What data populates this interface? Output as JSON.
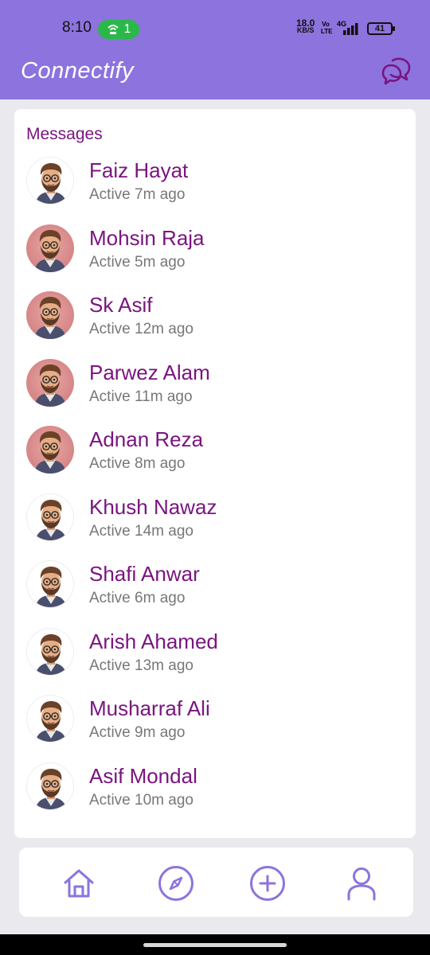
{
  "status_bar": {
    "time": "8:10",
    "hotspot_count": "1",
    "net_speed_value": "18.0",
    "net_speed_unit": "KB/S",
    "volte_label": "Vo LTE",
    "network_label": "4G",
    "battery": "41"
  },
  "app": {
    "title": "Connectify",
    "header_icon": "chat-bubbles-icon",
    "accent_color": "#8d73dd",
    "name_color": "#7a1580"
  },
  "messages": {
    "title": "Messages",
    "items": [
      {
        "name": "Faiz Hayat",
        "status": "Active 7m ago",
        "avatar": "plain"
      },
      {
        "name": "Mohsin Raja",
        "status": "Active 5m ago",
        "avatar": "pink"
      },
      {
        "name": "Sk Asif",
        "status": "Active 12m ago",
        "avatar": "pink"
      },
      {
        "name": "Parwez Alam",
        "status": "Active 11m ago",
        "avatar": "pink"
      },
      {
        "name": "Adnan Reza",
        "status": "Active 8m ago",
        "avatar": "pink"
      },
      {
        "name": "Khush Nawaz",
        "status": "Active 14m ago",
        "avatar": "plain"
      },
      {
        "name": "Shafi Anwar",
        "status": "Active 6m ago",
        "avatar": "plain"
      },
      {
        "name": "Arish Ahamed",
        "status": "Active 13m ago",
        "avatar": "plain"
      },
      {
        "name": "Musharraf Ali",
        "status": "Active 9m ago",
        "avatar": "plain"
      },
      {
        "name": "Asif Mondal",
        "status": "Active 10m ago",
        "avatar": "plain"
      }
    ]
  },
  "bottom_nav": {
    "items": [
      "home-icon",
      "compass-icon",
      "add-circle-icon",
      "profile-icon"
    ]
  }
}
